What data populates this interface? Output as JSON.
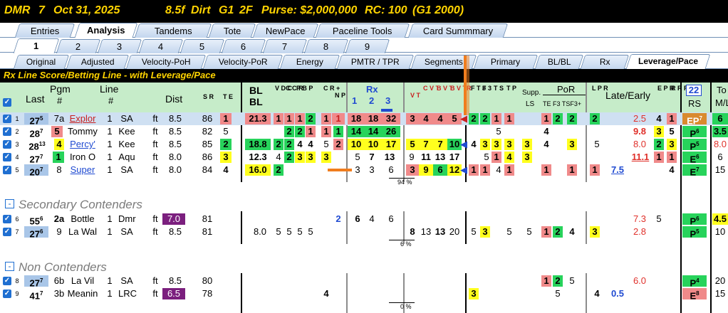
{
  "race_header": {
    "track": "DMR",
    "race": "7",
    "date": "Oct 31, 2025",
    "distance": "8.5f",
    "surface": "Dirt",
    "grade": "G1",
    "age": "2F",
    "purse": "Purse: $2,000,000",
    "rc": "RC: 100",
    "rc_note": "(G1 2000)"
  },
  "main_tabs": [
    "Entries",
    "Analysis",
    "Tandems",
    "Tote",
    "NewPace",
    "Paceline Tools",
    "Card Summmary"
  ],
  "race_tabs": [
    "1",
    "2",
    "3",
    "4",
    "5",
    "6",
    "7",
    "8",
    "9"
  ],
  "sub_tabs": [
    "Original",
    "Adjusted",
    "Velocity-PoH",
    "Velocity-PoR",
    "Energy",
    "PMTR / TPR",
    "Segments",
    "Primary",
    "BL/BL",
    "Rx",
    "Leverage/Pace"
  ],
  "banner": "Rx Line Score/Betting Line - with Leverage/Pace",
  "headers": {
    "last": "Last",
    "pgm": "Pgm",
    "pgm_sub": "#",
    "line": "Line",
    "line_sub": "#",
    "dist": "Dist",
    "sr": "S R",
    "te": "T E",
    "bl1": "BL",
    "bl2": "BL",
    "vdc": "V D C",
    "ccr": "C C R",
    "pbp": "P B P",
    "crp": "C R +",
    "np": "N P",
    "rx": "Rx",
    "rx_cols": [
      "1",
      "2",
      "3"
    ],
    "vt": "V T",
    "cvt": "C V T",
    "bvt": "B V T",
    "bvtr": "B V TR",
    "ft": "F T 3",
    "f3": "F 3",
    "ts": "T S",
    "tp": "T P",
    "supp": "Supp.",
    "ls": "LS",
    "por": "PoR",
    "por_sub": "TE F3 TSF3+",
    "lpr": "L P R",
    "late_early": "Late/Early",
    "epr": "E P R",
    "rrr": "R R R",
    "rs_num": "22",
    "rs": "RS",
    "to": "To",
    "ml": "M/L"
  },
  "sections": [
    {
      "label": "Secondary Contenders"
    },
    {
      "label": "Non Contenders"
    }
  ],
  "rows": [
    {
      "id": "1",
      "last": "27",
      "last_sup": "5",
      "pgm": "7a",
      "name": "Explor",
      "line": "1",
      "trk": "SA",
      "surf": "ft",
      "dist": "8.5",
      "sr": "86",
      "te": "1",
      "bl": "21.3",
      "v": [
        "1",
        "1",
        "1",
        "2"
      ],
      "cr": "1",
      "np": "",
      "rx": [
        "18",
        "18",
        "32"
      ],
      "vt": [
        "3",
        "4",
        "4",
        "5"
      ],
      "p": [
        "2",
        "2",
        "1",
        "1"
      ],
      "supp": "1",
      "ls": "2",
      "por": "2",
      "lpr": "2",
      "le": "2.5",
      "epr": "4",
      "rrr": "1",
      "rs": "EP",
      "rs_sup": "7",
      "ml": "6"
    },
    {
      "id": "2",
      "last": "28",
      "last_sup": "7",
      "pgm": "5",
      "name": "Tommy",
      "line": "1",
      "trk": "Kee",
      "surf": "ft",
      "dist": "8.5",
      "sr": "82",
      "te": "5",
      "bl": "",
      "v": [
        "",
        "2",
        "2",
        "1"
      ],
      "cr": "1",
      "np": "1",
      "rx": [
        "14",
        "14",
        "26"
      ],
      "vt": [
        "",
        "",
        "",
        ""
      ],
      "p": [
        "",
        "",
        "5",
        ""
      ],
      "supp": "4",
      "ls": "",
      "por": "",
      "lpr": "",
      "le": "9.8",
      "epr": "3",
      "rrr": "5",
      "rs": "P",
      "rs_sup": "6",
      "ml": "3.5"
    },
    {
      "id": "3",
      "last": "28",
      "last_sup": "13",
      "pgm": "4",
      "name": "Percy'",
      "line": "1",
      "trk": "Kee",
      "surf": "ft",
      "dist": "8.5",
      "sr": "85",
      "te": "2",
      "bl": "18.8",
      "v": [
        "2",
        "2",
        "4",
        "4"
      ],
      "cr": "5",
      "np": "2",
      "rx": [
        "10",
        "10",
        "17"
      ],
      "vt": [
        "5",
        "7",
        "7",
        "10"
      ],
      "p": [
        "4",
        "3",
        "3",
        "3"
      ],
      "supp": "3",
      "ls": "4",
      "por": "3",
      "lpr": "5",
      "le": "8.0",
      "epr": "2",
      "rrr": "3",
      "rs": "P",
      "rs_sup": "5",
      "ml": "8.0"
    },
    {
      "id": "4",
      "last": "27",
      "last_sup": "7",
      "pgm": "1",
      "name": "Iron O",
      "line": "1",
      "trk": "Aqu",
      "surf": "ft",
      "dist": "8.0",
      "sr": "86",
      "te": "3",
      "bl": "12.3",
      "v": [
        "4",
        "2",
        "3",
        "3"
      ],
      "cr": "3",
      "np": "",
      "rx": [
        "5",
        "7",
        "13"
      ],
      "vt": [
        "9",
        "11",
        "13",
        "17"
      ],
      "p": [
        "",
        "5",
        "1",
        "4"
      ],
      "supp": "3",
      "ls": "",
      "por": "",
      "lpr": "",
      "le": "11.1",
      "epr": "1",
      "rrr": "1",
      "rs": "E",
      "rs_sup": "6",
      "ml": "6"
    },
    {
      "id": "5",
      "last": "20",
      "last_sup": "7",
      "pgm": "8",
      "name": "Super",
      "line": "1",
      "trk": "SA",
      "surf": "ft",
      "dist": "8.0",
      "sr": "84",
      "te": "4",
      "bl": "16.0",
      "v": [
        "2",
        "",
        "",
        ""
      ],
      "cr": "",
      "np": "",
      "rx": [
        "3",
        "3",
        "6"
      ],
      "vt": [
        "3",
        "9",
        "6",
        "12"
      ],
      "p": [
        "1",
        "1",
        "4",
        "1"
      ],
      "supp": "1",
      "ls": "1",
      "por": "1",
      "lpr": "1",
      "lpr2": "7.5",
      "le": "",
      "epr": "",
      "rrr": "4",
      "rs": "E",
      "rs_sup": "7",
      "ml": "15"
    },
    {
      "id": "6",
      "last": "55",
      "last_sup": "6",
      "pgm": "2a",
      "name": "Bottle",
      "line": "1",
      "trk": "Dmr",
      "surf": "ft",
      "dist": "7.0",
      "sr": "81",
      "te": "",
      "bl": "",
      "v": [
        "",
        "",
        "",
        ""
      ],
      "cr": "",
      "np": "2",
      "rx": [
        "6",
        "4",
        "6"
      ],
      "vt": [
        "",
        "",
        "",
        ""
      ],
      "p": [
        "",
        "",
        "",
        ""
      ],
      "supp": "",
      "ls": "",
      "por": "",
      "lpr": "",
      "le": "7.3",
      "epr": "5",
      "rrr": "",
      "rs": "P",
      "rs_sup": "6",
      "ml": "4.5"
    },
    {
      "id": "7",
      "last": "27",
      "last_sup": "6",
      "pgm": "9",
      "name": "La Wal",
      "line": "1",
      "trk": "SA",
      "surf": "ft",
      "dist": "8.5",
      "sr": "81",
      "te": "",
      "bl": "8.0",
      "v": [
        "5",
        "5",
        "5",
        "5"
      ],
      "cr": "",
      "np": "",
      "rx": [
        "",
        "",
        "8"
      ],
      "vt": [
        "13",
        "13",
        "20",
        ""
      ],
      "p": [
        "5",
        "3",
        "",
        "5"
      ],
      "supp": "5",
      "ls": "1",
      "por": "2",
      "lpr": "4",
      "lpr2": "3",
      "le": "2.8",
      "epr": "",
      "rrr": "",
      "rs": "P",
      "rs_sup": "5",
      "ml": "10"
    },
    {
      "id": "8",
      "last": "27",
      "last_sup": "7",
      "pgm": "6b",
      "name": "La Vil",
      "line": "1",
      "trk": "SA",
      "surf": "ft",
      "dist": "8.5",
      "sr": "80",
      "te": "",
      "bl": "",
      "v": [
        "",
        "",
        "",
        ""
      ],
      "cr": "",
      "np": "",
      "rx": [
        "",
        "",
        ""
      ],
      "vt": [
        "",
        "",
        "",
        ""
      ],
      "p": [
        "",
        "",
        "",
        ""
      ],
      "supp": "1",
      "ls": "2",
      "por": "5",
      "lpr": "",
      "le": "6.0",
      "epr": "",
      "rrr": "",
      "rs": "P",
      "rs_sup": "4",
      "ml": "20"
    },
    {
      "id": "9",
      "last": "41",
      "last_sup": "7",
      "pgm": "3b",
      "name": "Meanin",
      "line": "1",
      "trk": "LRC",
      "surf": "ft",
      "dist": "6.5",
      "sr": "78",
      "te": "",
      "bl": "",
      "v": [
        "",
        "",
        "",
        ""
      ],
      "cr": "4",
      "np": "",
      "rx": [
        "",
        "",
        ""
      ],
      "vt": [
        "",
        "",
        "",
        ""
      ],
      "p": [
        "3",
        "",
        "",
        ""
      ],
      "supp": "5",
      "ls": "",
      "por": "4",
      "lpr": "0.5",
      "le": "",
      "epr": "",
      "rrr": "",
      "rs": "E",
      "rs_sup": "8",
      "ml": "15"
    }
  ],
  "pcts": [
    "94 %",
    "6 %",
    "0 %"
  ],
  "colors": {
    "title_bg": "#000000",
    "title_fg": "#ffd400",
    "header_bg": "#c6ecc9",
    "pink": "#f08a8a",
    "green": "#27d35b",
    "yellow": "#ffff1e",
    "purple": "#7b1f7e",
    "orange": "#f07d1e"
  }
}
